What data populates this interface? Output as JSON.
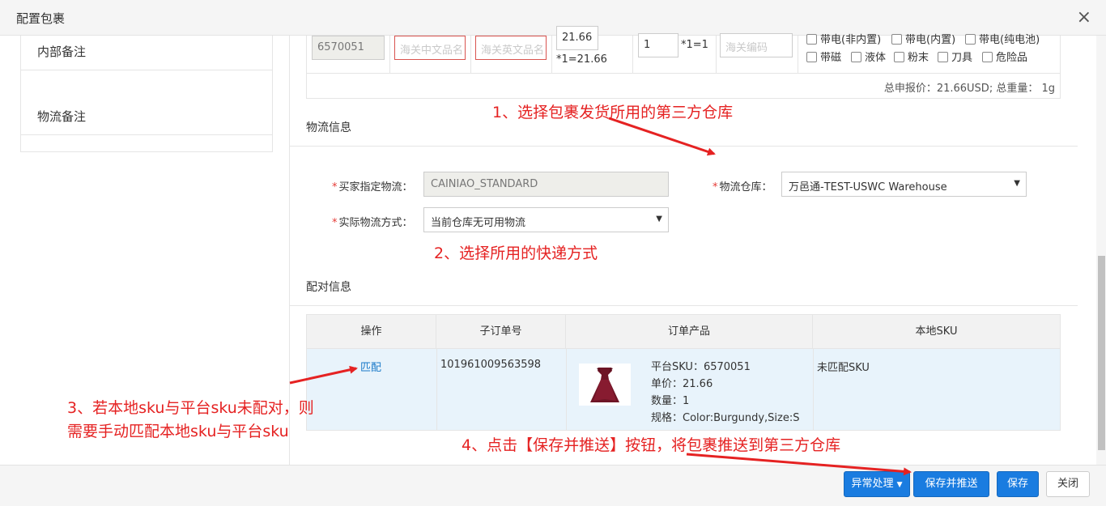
{
  "modal": {
    "title": "配置包裹",
    "close_icon": "×"
  },
  "left": {
    "internal_note": "内部备注",
    "logistics_note": "物流备注"
  },
  "product": {
    "sku": "6570051",
    "cn_name_placeholder": "海关中文品名",
    "en_name_placeholder": "海关英文品名",
    "price": "21.66",
    "price_calc": "*1=21.66",
    "qty": "1",
    "qty_calc": "*1=1",
    "hs_placeholder": "海关编码",
    "checkboxes_row1": [
      "带电(非内置)",
      "带电(内置)",
      "带电(纯电池)"
    ],
    "checkboxes_row2": [
      "带磁",
      "液体",
      "粉末",
      "刀具",
      "危险品"
    ],
    "summary": "总申报价：21.66USD; 总重量： 1g"
  },
  "logistics": {
    "section_title": "物流信息",
    "buyer_label": "买家指定物流：",
    "buyer_value": "CAINIAO_STANDARD",
    "warehouse_label": "物流仓库：",
    "warehouse_value": "万邑通-TEST-USWC Warehouse",
    "method_label": "实际物流方式：",
    "method_value": "当前仓库无可用物流"
  },
  "match": {
    "section_title": "配对信息",
    "headers": [
      "操作",
      "子订单号",
      "订单产品",
      "本地SKU"
    ],
    "row": {
      "action": "匹配",
      "sub_order": "101961009563598",
      "platform_sku": "平台SKU：6570051",
      "unit_price": "单价：21.66",
      "quantity": "数量：1",
      "spec": "规格：Color:Burgundy,Size:S",
      "local_sku": "未匹配SKU"
    }
  },
  "annotations": {
    "a1": "1、选择包裹发货所用的第三方仓库",
    "a2": "2、选择所用的快递方式",
    "a3_line1": "3、若本地sku与平台sku未配对，则",
    "a3_line2": "需要手动匹配本地sku与平台sku",
    "a4": "4、点击【保存并推送】按钮，将包裹推送到第三方仓库"
  },
  "footer": {
    "exception": "异常处理",
    "save_push": "保存并推送",
    "save": "保存",
    "close": "关闭"
  },
  "colors": {
    "primary": "#1a7ce0",
    "annotation": "#e52222",
    "link": "#1a7ac9",
    "row_highlight": "#e8f3fb"
  }
}
